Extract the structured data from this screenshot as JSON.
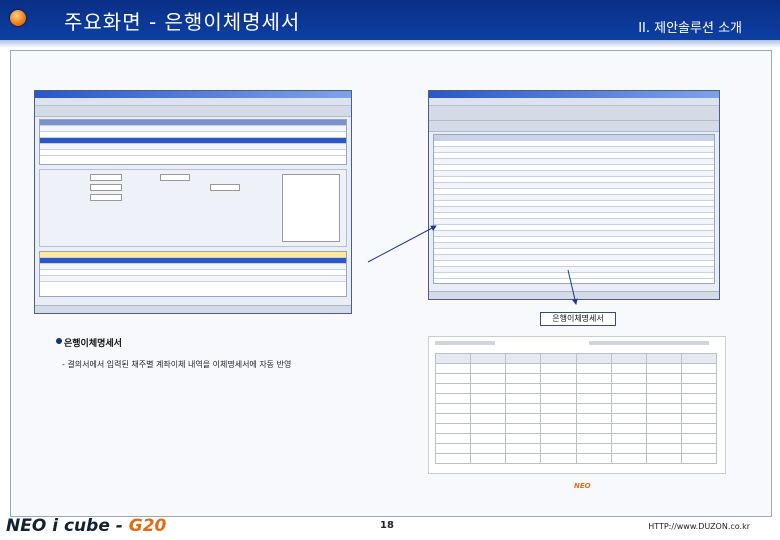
{
  "header": {
    "title": "주요화면 - 은행이체명세서",
    "section": "II. 제안솔루션 소개"
  },
  "callout": {
    "label": "은행이체명세서"
  },
  "body": {
    "section_title": "은행이체명세서",
    "description": "- 결의서에서 입력된 채주별 계좌이체 내역을 이체명세서에 자동 반영"
  },
  "footer": {
    "logo_prefix": "NEO ",
    "logo_main": "i cube - ",
    "logo_accent": "G20",
    "page": "18",
    "url": "HTTP://www.DUZON.co.kr"
  },
  "colors": {
    "header_bg": "#0a2f86",
    "accent": "#e26c12",
    "selection": "#2b56c7"
  }
}
